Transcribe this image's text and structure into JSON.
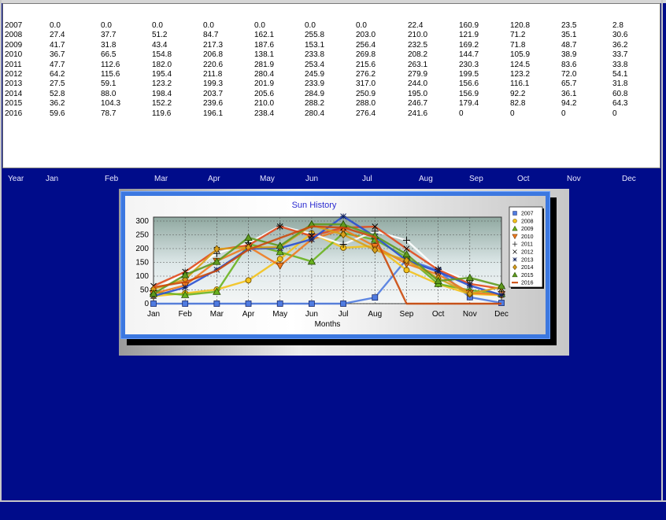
{
  "table": {
    "rows": [
      {
        "year": "2007",
        "values": [
          "0.0",
          "0.0",
          "0.0",
          "0.0",
          "0.0",
          "0.0",
          "0.0",
          "22.4",
          "160.9",
          "120.8",
          "23.5",
          "2.8"
        ]
      },
      {
        "year": "2008",
        "values": [
          "27.4",
          "37.7",
          "51.2",
          "84.7",
          "162.1",
          "255.8",
          "203.0",
          "210.0",
          "121.9",
          "71.2",
          "35.1",
          "30.6"
        ]
      },
      {
        "year": "2009",
        "values": [
          "41.7",
          "31.8",
          "43.4",
          "217.3",
          "187.6",
          "153.1",
          "256.4",
          "232.5",
          "169.2",
          "71.8",
          "48.7",
          "36.2"
        ]
      },
      {
        "year": "2010",
        "values": [
          "36.7",
          "66.5",
          "154.8",
          "206.8",
          "138.1",
          "233.8",
          "269.8",
          "208.2",
          "144.7",
          "105.9",
          "38.9",
          "33.7"
        ]
      },
      {
        "year": "2011",
        "values": [
          "47.7",
          "112.6",
          "182.0",
          "220.6",
          "281.9",
          "253.4",
          "215.6",
          "263.1",
          "230.3",
          "124.5",
          "83.6",
          "33.8"
        ]
      },
      {
        "year": "2012",
        "values": [
          "64.2",
          "115.6",
          "195.4",
          "211.8",
          "280.4",
          "245.9",
          "276.2",
          "279.9",
          "199.5",
          "123.2",
          "72.0",
          "54.1"
        ]
      },
      {
        "year": "2013",
        "values": [
          "27.5",
          "59.1",
          "123.2",
          "199.3",
          "201.9",
          "233.9",
          "317.0",
          "244.0",
          "156.6",
          "116.1",
          "65.7",
          "31.8"
        ]
      },
      {
        "year": "2014",
        "values": [
          "52.8",
          "88.0",
          "198.4",
          "203.7",
          "205.6",
          "284.9",
          "250.9",
          "195.0",
          "156.9",
          "92.2",
          "36.1",
          "60.8"
        ]
      },
      {
        "year": "2015",
        "values": [
          "36.2",
          "104.3",
          "152.2",
          "239.6",
          "210.0",
          "288.2",
          "288.0",
          "246.7",
          "179.4",
          "82.8",
          "94.2",
          "64.3"
        ]
      },
      {
        "year": "2016",
        "values": [
          "59.6",
          "78.7",
          "119.6",
          "196.1",
          "238.4",
          "280.4",
          "276.4",
          "241.6",
          "0",
          "0",
          "0",
          "0"
        ]
      }
    ]
  },
  "header": {
    "labels": [
      "Year",
      "Jan",
      "Feb",
      "Mar",
      "Apr",
      "May",
      "Jun",
      "Jul",
      "Aug",
      "Sep",
      "Oct",
      "Nov",
      "Dec"
    ]
  },
  "chart_data": {
    "type": "line",
    "title": "Sun History",
    "xlabel": "Months",
    "ylabel": "",
    "categories": [
      "Jan",
      "Feb",
      "Mar",
      "Apr",
      "May",
      "Jun",
      "Jul",
      "Aug",
      "Sep",
      "Oct",
      "Nov",
      "Dec"
    ],
    "ylim": [
      0,
      300
    ],
    "yticks": [
      "0",
      "50",
      "100",
      "150",
      "200",
      "250",
      "300"
    ],
    "grid": true,
    "legend": "right",
    "series": [
      {
        "name": "2007",
        "color": "#4f7be0",
        "marker": "square",
        "values": [
          0,
          0,
          0,
          0,
          0,
          0,
          0,
          22.4,
          160.9,
          120.8,
          23.5,
          2.8
        ]
      },
      {
        "name": "2008",
        "color": "#f3c21b",
        "marker": "circle",
        "values": [
          27.4,
          37.7,
          51.2,
          84.7,
          162.1,
          255.8,
          203.0,
          210.0,
          121.9,
          71.2,
          35.1,
          30.6
        ]
      },
      {
        "name": "2009",
        "color": "#6ab21f",
        "marker": "triangle",
        "values": [
          41.7,
          31.8,
          43.4,
          217.3,
          187.6,
          153.1,
          256.4,
          232.5,
          169.2,
          71.8,
          48.7,
          36.2
        ]
      },
      {
        "name": "2010",
        "color": "#f07a1e",
        "marker": "triangle-down",
        "values": [
          36.7,
          66.5,
          154.8,
          206.8,
          138.1,
          233.8,
          269.8,
          208.2,
          144.7,
          105.9,
          38.9,
          33.7
        ]
      },
      {
        "name": "2011",
        "color": "#ffffff",
        "marker": "plus",
        "values": [
          47.7,
          112.6,
          182.0,
          220.6,
          281.9,
          253.4,
          215.6,
          263.1,
          230.3,
          124.5,
          83.6,
          33.8
        ]
      },
      {
        "name": "2012",
        "color": "#e24a1c",
        "marker": "x",
        "values": [
          64.2,
          115.6,
          195.4,
          211.8,
          280.4,
          245.9,
          276.2,
          279.9,
          199.5,
          123.2,
          72.0,
          54.1
        ]
      },
      {
        "name": "2013",
        "color": "#2a4fd0",
        "marker": "star",
        "values": [
          27.5,
          59.1,
          123.2,
          199.3,
          201.9,
          233.9,
          317.0,
          244.0,
          156.6,
          116.1,
          65.7,
          31.8
        ]
      },
      {
        "name": "2014",
        "color": "#d8a01a",
        "marker": "diamond",
        "values": [
          52.8,
          88.0,
          198.4,
          203.7,
          205.6,
          284.9,
          250.9,
          195.0,
          156.9,
          92.2,
          36.1,
          60.8
        ]
      },
      {
        "name": "2015",
        "color": "#5f9a1f",
        "marker": "triangle",
        "values": [
          36.2,
          104.3,
          152.2,
          239.6,
          210.0,
          288.2,
          288.0,
          246.7,
          179.4,
          82.8,
          94.2,
          64.3
        ]
      },
      {
        "name": "2016",
        "color": "#cc4a0c",
        "marker": "dash",
        "values": [
          59.6,
          78.7,
          119.6,
          196.1,
          238.4,
          280.4,
          276.4,
          241.6,
          0,
          0,
          0,
          0
        ]
      }
    ]
  }
}
